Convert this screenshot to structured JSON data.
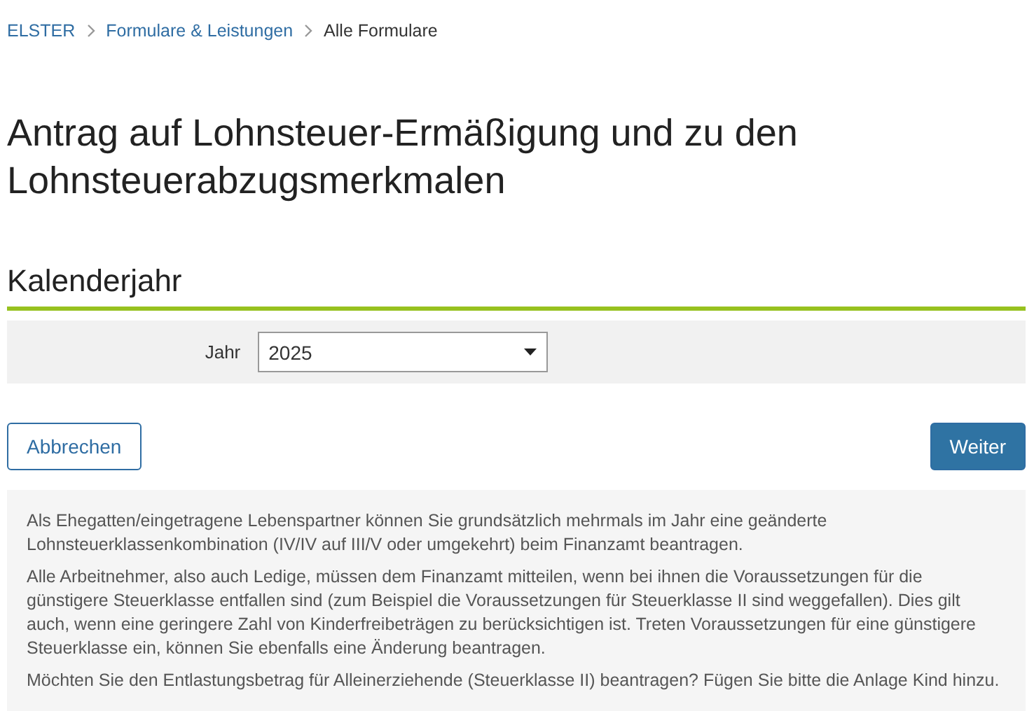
{
  "breadcrumb": [
    {
      "label": "ELSTER",
      "link": true
    },
    {
      "label": "Formulare & Leistungen",
      "link": true
    },
    {
      "label": "Alle Formulare",
      "link": false
    }
  ],
  "title": "Antrag auf Lohnsteuer-Ermäßigung und zu den Lohnsteuerabzugsmerkmalen",
  "section": {
    "heading": "Kalenderjahr",
    "field": {
      "label": "Jahr",
      "value": "2025"
    }
  },
  "buttons": {
    "cancel": "Abbrechen",
    "next": "Weiter"
  },
  "info": [
    "Als Ehegatten/eingetragene Lebenspartner können Sie grundsätzlich mehrmals im Jahr eine geänderte Lohnsteuerklassenkombination (IV/IV auf III/V oder umgekehrt) beim Finanzamt beantragen.",
    "Alle Arbeitnehmer, also auch Ledige, müssen dem Finanzamt mitteilen, wenn bei ihnen die Voraussetzungen für die günstigere Steuerklasse entfallen sind (zum Beispiel die Voraussetzungen für Steuerklasse II sind weggefallen). Dies gilt auch, wenn eine geringere Zahl von Kinderfreibeträgen zu berücksichtigen ist. Treten Voraussetzungen für eine günstigere Steuerklasse ein, können Sie ebenfalls eine Änderung beantragen.",
    "Möchten Sie den Entlastungsbetrag für Alleinerziehende (Steuerklasse II) beantragen? Fügen Sie bitte die Anlage Kind hinzu."
  ]
}
